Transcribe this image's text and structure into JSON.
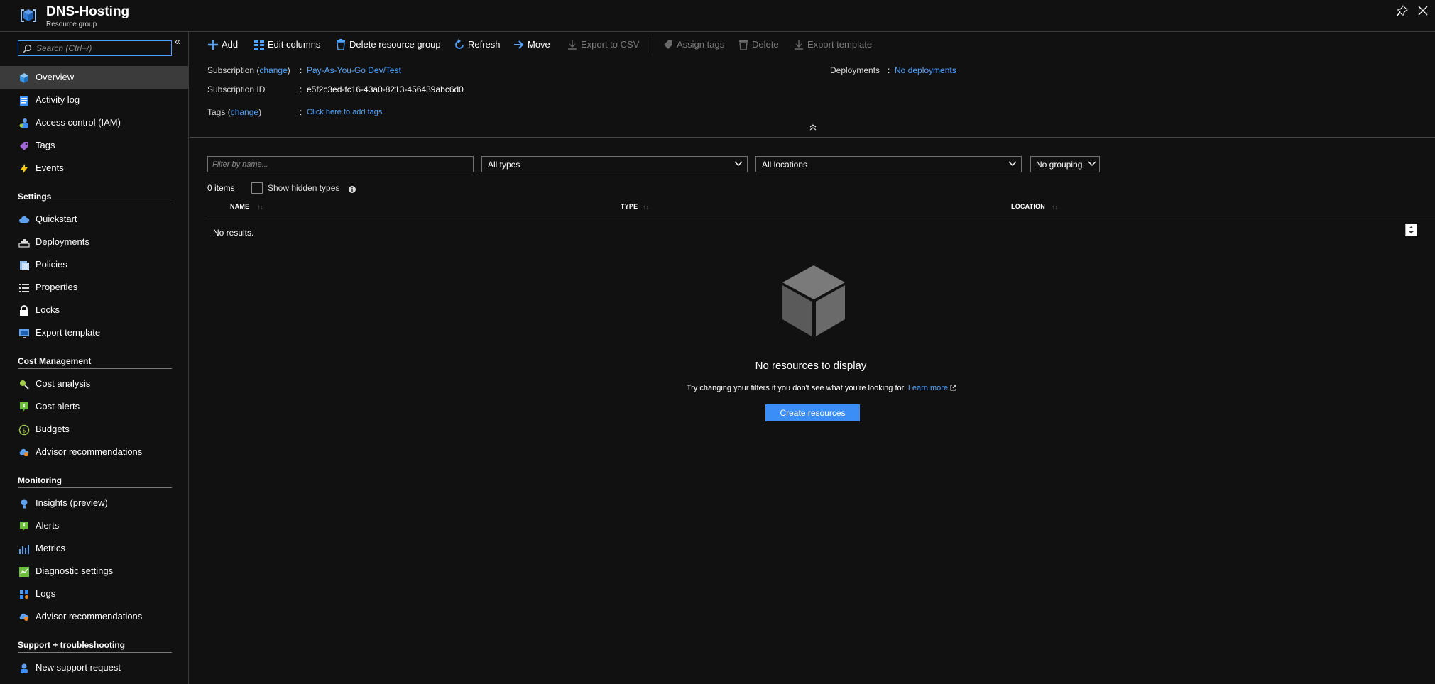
{
  "header": {
    "title": "DNS-Hosting",
    "subtitle": "Resource group"
  },
  "sidebar": {
    "search_placeholder": "Search (Ctrl+/)",
    "collapse_glyph": "«",
    "top_items": [
      {
        "label": "Overview",
        "icon": "overview-icon"
      },
      {
        "label": "Activity log",
        "icon": "activity-log-icon"
      },
      {
        "label": "Access control (IAM)",
        "icon": "access-control-icon"
      },
      {
        "label": "Tags",
        "icon": "tag-icon"
      },
      {
        "label": "Events",
        "icon": "lightning-icon"
      }
    ],
    "sections": [
      {
        "title": "Settings",
        "items": [
          {
            "label": "Quickstart",
            "icon": "cloud-icon"
          },
          {
            "label": "Deployments",
            "icon": "deployments-icon"
          },
          {
            "label": "Policies",
            "icon": "policies-icon"
          },
          {
            "label": "Properties",
            "icon": "properties-icon"
          },
          {
            "label": "Locks",
            "icon": "lock-icon"
          },
          {
            "label": "Export template",
            "icon": "export-template-icon"
          }
        ]
      },
      {
        "title": "Cost Management",
        "items": [
          {
            "label": "Cost analysis",
            "icon": "cost-analysis-icon"
          },
          {
            "label": "Cost alerts",
            "icon": "cost-alerts-icon"
          },
          {
            "label": "Budgets",
            "icon": "budgets-icon"
          },
          {
            "label": "Advisor recommendations",
            "icon": "advisor-icon"
          }
        ]
      },
      {
        "title": "Monitoring",
        "items": [
          {
            "label": "Insights (preview)",
            "icon": "insights-icon"
          },
          {
            "label": "Alerts",
            "icon": "alerts-icon"
          },
          {
            "label": "Metrics",
            "icon": "metrics-icon"
          },
          {
            "label": "Diagnostic settings",
            "icon": "diagnostic-icon"
          },
          {
            "label": "Logs",
            "icon": "logs-icon"
          },
          {
            "label": "Advisor recommendations",
            "icon": "advisor-icon"
          }
        ]
      },
      {
        "title": "Support + troubleshooting",
        "items": [
          {
            "label": "New support request",
            "icon": "support-icon"
          }
        ]
      }
    ]
  },
  "toolbar": {
    "add": "Add",
    "edit_columns": "Edit columns",
    "delete_resource_group": "Delete resource group",
    "refresh": "Refresh",
    "move": "Move",
    "export_csv": "Export to CSV",
    "assign_tags": "Assign tags",
    "delete": "Delete",
    "export_template": "Export template"
  },
  "essentials": {
    "subscription_label": "Subscription",
    "change_link": "change",
    "subscription_value": "Pay-As-You-Go Dev/Test",
    "subscription_id_label": "Subscription ID",
    "subscription_id_value": "e5f2c3ed-fc16-43a0-8213-456439abc6d0",
    "tags_label": "Tags",
    "tags_value": "Click here to add tags",
    "deployments_label": "Deployments",
    "deployments_value": "No deployments"
  },
  "filters": {
    "name_placeholder": "Filter by name...",
    "types_value": "All types",
    "locations_value": "All locations",
    "grouping_value": "No grouping"
  },
  "list": {
    "items_count": "0 items",
    "show_hidden_label": "Show hidden types",
    "columns": [
      "NAME",
      "TYPE",
      "LOCATION"
    ],
    "no_results": "No results."
  },
  "empty_state": {
    "title": "No resources to display",
    "description": "Try changing your filters if you don't see what you're looking for.",
    "learn_more": "Learn more",
    "create_button": "Create resources"
  },
  "colors": {
    "background": "#111111",
    "accent": "#4fa3ff",
    "primary_button": "#3b8ef5",
    "selected_nav": "#3b3b3b"
  }
}
